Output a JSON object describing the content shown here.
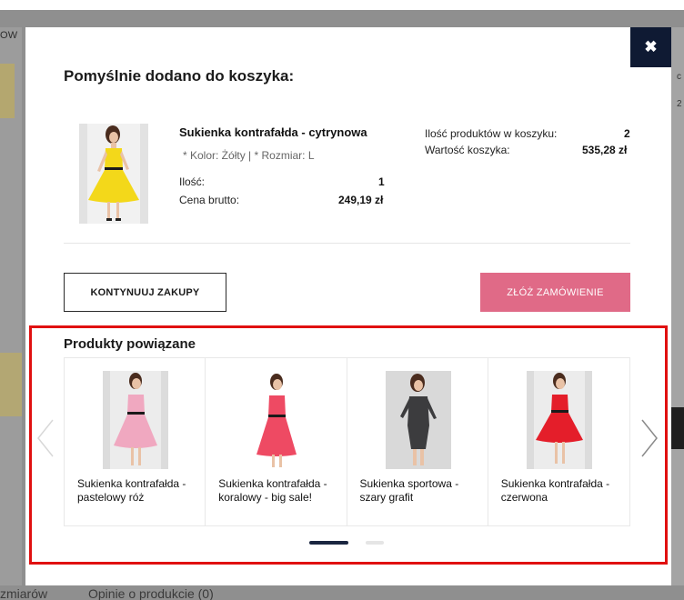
{
  "background": {
    "left_fragment": "OW",
    "right_fragment_top": "c",
    "right_fragment_bottom": "2",
    "bottom_tab_partial": "zmiarów",
    "bottom_tab_reviews": "Opinie o produkcie (0)"
  },
  "modal": {
    "title": "Pomyślnie dodano do koszyka:",
    "close_icon": "close-icon",
    "product": {
      "name": "Sukienka kontrafałda - cytrynowa",
      "attributes": "* Kolor: Żółty  |   * Rozmiar: L",
      "quantity_label": "Ilość:",
      "quantity_value": "1",
      "price_label": "Cena brutto:",
      "price_value": "249,19 zł"
    },
    "cart": {
      "count_label": "Ilość produktów w koszyku:",
      "count_value": "2",
      "value_label": "Wartość koszyka:",
      "value_value": "535,28 zł"
    },
    "buttons": {
      "continue_label": "KONTYNUUJ ZAKUPY",
      "order_label": "ZŁÓŻ ZAMÓWIENIE"
    },
    "related": {
      "title": "Produkty powiązane",
      "items": [
        {
          "name": "Sukienka kontrafałda - pastelowy róż",
          "color": "#f0a8c0"
        },
        {
          "name": "Sukienka kontrafałda - koralowy - big sale!",
          "color": "#ee4a63"
        },
        {
          "name": "Sukienka sportowa - szary grafit",
          "color": "#3c3c3e"
        },
        {
          "name": "Sukienka kontrafałda - czerwona",
          "color": "#e41e2a"
        }
      ],
      "arrow_left_icon": "chevron-left-icon",
      "arrow_right_icon": "chevron-right-icon"
    }
  },
  "colors": {
    "accent_dark": "#0f1a33",
    "order_button": "#e06a87",
    "highlight_frame": "#e01010",
    "main_dress": "#f3d81a"
  }
}
